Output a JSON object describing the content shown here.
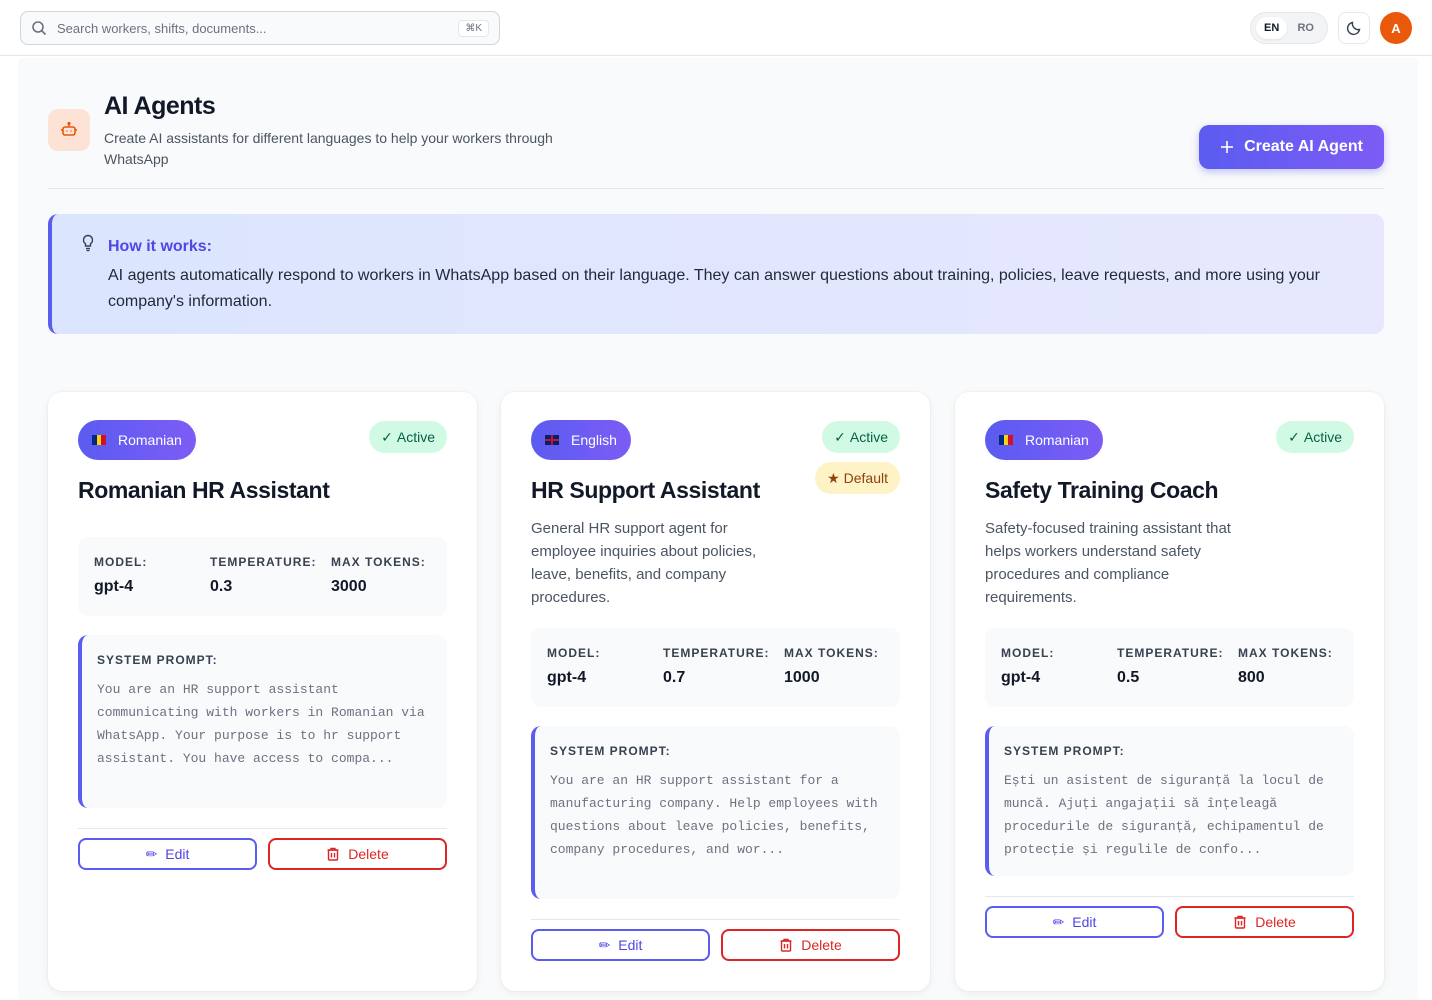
{
  "search": {
    "placeholder": "Search workers, shifts, documents...",
    "shortcut": "⌘K"
  },
  "languages": {
    "en": "EN",
    "ro": "RO",
    "active": "EN"
  },
  "user": {
    "initial": "A"
  },
  "page": {
    "title": "AI Agents",
    "subtitle": "Create AI assistants for different languages to help your workers through WhatsApp",
    "create_label": "Create AI Agent"
  },
  "info": {
    "title": "How it works:",
    "text": "AI agents automatically respond to workers in WhatsApp based on their language. They can answer questions about training, policies, leave requests, and more using your company's information."
  },
  "labels": {
    "model": "MODEL:",
    "temperature": "TEMPERATURE:",
    "max_tokens": "MAX TOKENS:",
    "system_prompt": "SYSTEM PROMPT:",
    "active": "Active",
    "default": "Default",
    "edit": "Edit",
    "delete": "Delete"
  },
  "agents": [
    {
      "language": "Romanian",
      "title": "Romanian HR Assistant",
      "description": "",
      "model": "gpt-4",
      "temperature": "0.3",
      "max_tokens": "3000",
      "prompt": "You are an HR support assistant communicating with workers in Romanian via WhatsApp. Your purpose is to hr support assistant. You have access to compa..."
    },
    {
      "language": "English",
      "title": "HR Support Assistant",
      "description": "General HR support agent for employee inquiries about policies, leave, benefits, and company procedures.",
      "model": "gpt-4",
      "temperature": "0.7",
      "max_tokens": "1000",
      "prompt": "You are an HR support assistant for a manufacturing company. Help employees with questions about leave policies, benefits, company procedures, and wor..."
    },
    {
      "language": "Romanian",
      "title": "Safety Training Coach",
      "description": "Safety-focused training assistant that helps workers understand safety procedures and compliance requirements.",
      "model": "gpt-4",
      "temperature": "0.5",
      "max_tokens": "800",
      "prompt": "Ești un asistent de siguranță la locul de muncă. Ajuți angajații să înțeleagă procedurile de siguranță, echipamentul de protecție și regulile de confo..."
    }
  ],
  "colors": {
    "accent": "#5b5cf0",
    "danger": "#dc2626",
    "success_bg": "#d1fae5",
    "avatar": "#ea580c"
  }
}
